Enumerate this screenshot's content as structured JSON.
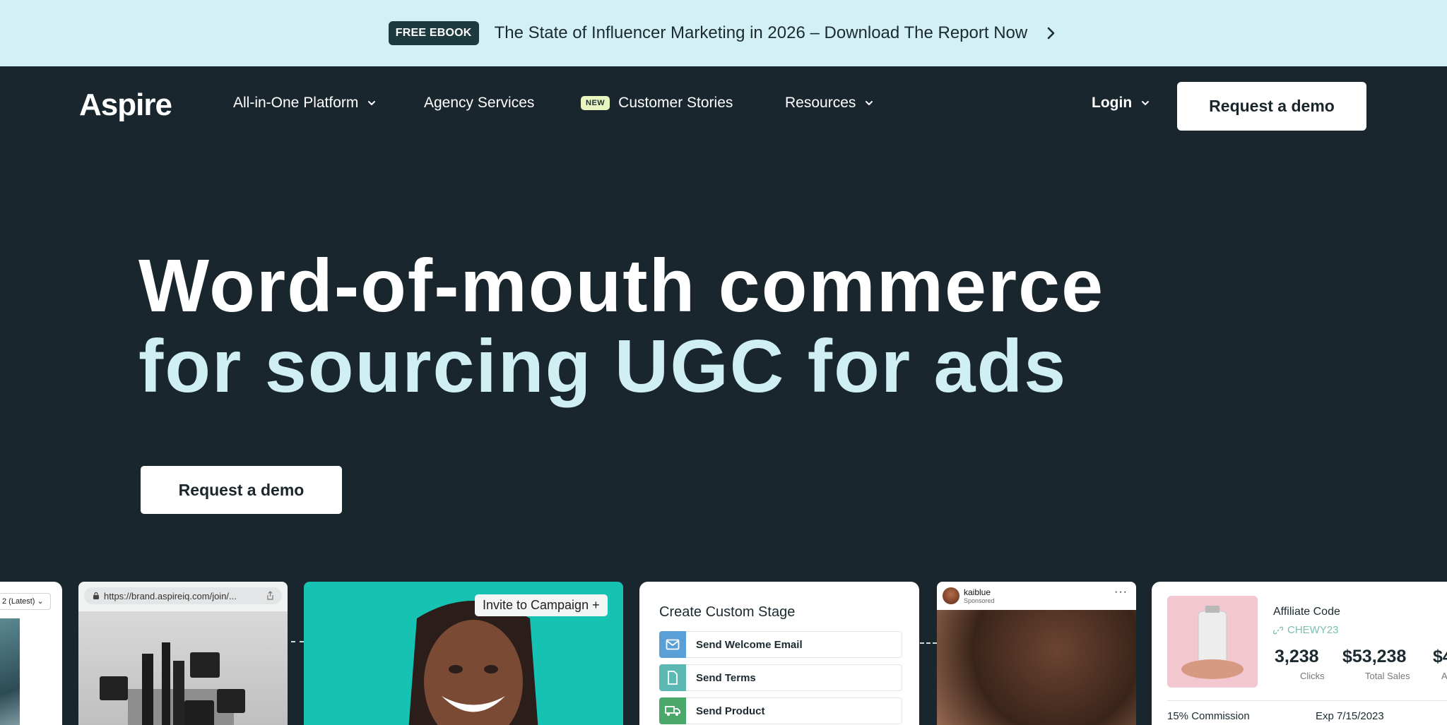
{
  "announcement": {
    "badge": "FREE EBOOK",
    "text": "The State of Influencer Marketing in 2026 – Download The Report Now"
  },
  "nav": {
    "logo": "Aspire",
    "items": [
      {
        "label": "All-in-One Platform",
        "has_dropdown": true
      },
      {
        "label": "Agency Services",
        "has_dropdown": false
      },
      {
        "label": "Customer Stories",
        "badge": "NEW",
        "has_dropdown": false
      },
      {
        "label": "Resources",
        "has_dropdown": true
      }
    ],
    "login": "Login",
    "cta": "Request a demo"
  },
  "hero": {
    "line1": "Word-of-mouth commerce",
    "line2": "for sourcing UGC for ads",
    "cta": "Request a demo"
  },
  "cards": {
    "version_select": "2 (Latest)",
    "browser_url": "https://brand.aspireiq.com/join/...",
    "invite_pill": "Invite to Campaign +",
    "stage": {
      "title": "Create Custom Stage",
      "rows": [
        "Send Welcome Email",
        "Send Terms",
        "Send Product"
      ],
      "icon_names": [
        "envelope-icon",
        "document-icon",
        "truck-icon"
      ],
      "icon_colors": [
        "#5a9fd6",
        "#5cb8b2",
        "#4aa86a"
      ]
    },
    "social": {
      "username": "kaiblue",
      "sponsored": "Sponsored"
    },
    "affiliate": {
      "title": "Affiliate Code",
      "code": "CHEWY23",
      "stats": [
        {
          "value": "3,238",
          "label": "Clicks"
        },
        {
          "value": "$53,238",
          "label": "Total Sales"
        },
        {
          "value": "$4",
          "label": "A"
        }
      ],
      "commission": "15% Commission",
      "expiry": "Exp 7/15/2023"
    }
  },
  "colors": {
    "background": "#19262d",
    "announcement_bg": "#d3f1f4",
    "hero_accent": "#cfeff2"
  }
}
